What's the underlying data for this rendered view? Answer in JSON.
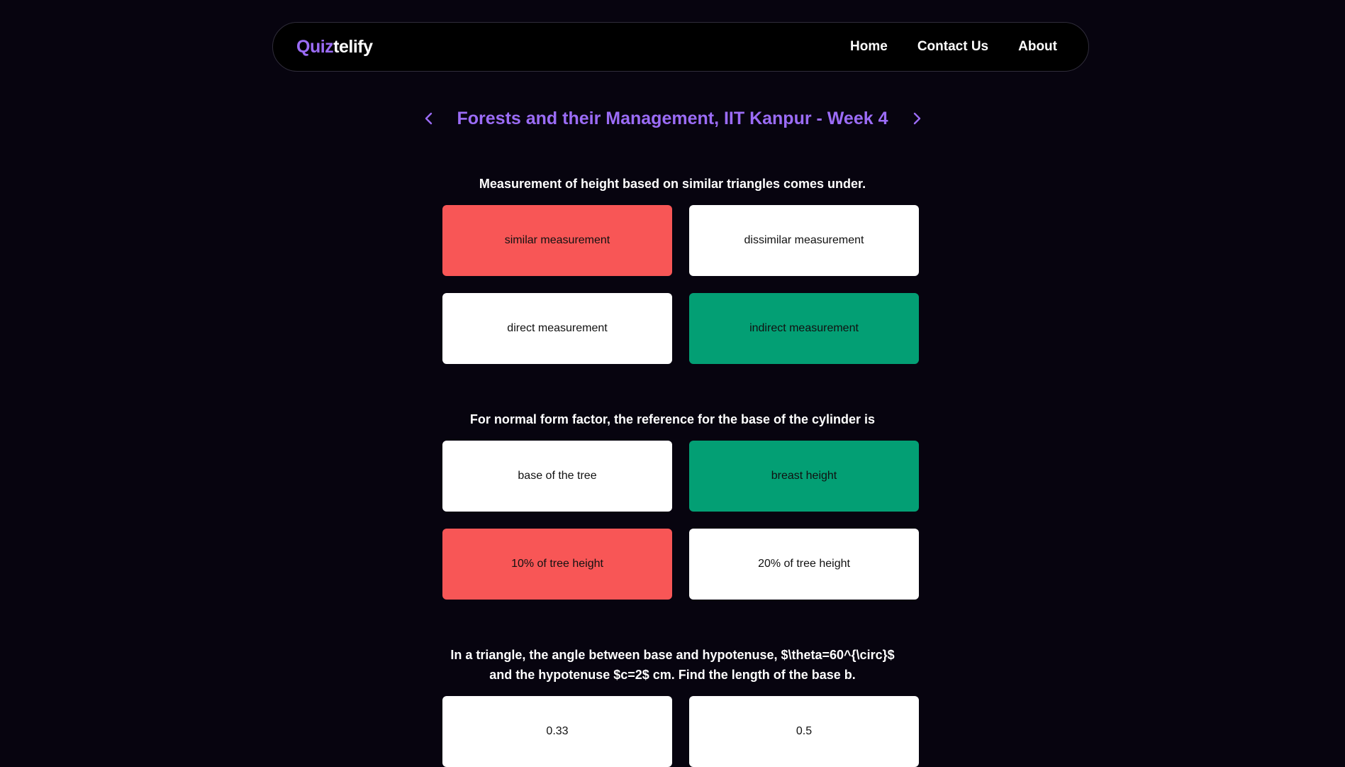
{
  "nav": {
    "logo_part1": "Quiz",
    "logo_part2": "telify",
    "links": [
      "Home",
      "Contact Us",
      "About"
    ]
  },
  "header": {
    "title": "Forests and their Management, IIT Kanpur - Week 4",
    "prev_icon": "chevron-left-icon",
    "next_icon": "chevron-right-icon"
  },
  "colors": {
    "accent": "#9b6cf6",
    "wrong": "#f85656",
    "correct": "#039f74",
    "background": "#07040f"
  },
  "questions": [
    {
      "text": "Measurement of height based on similar triangles comes under.",
      "options": [
        {
          "label": "similar measurement",
          "state": "wrong"
        },
        {
          "label": "dissimilar measurement",
          "state": "neutral"
        },
        {
          "label": "direct measurement",
          "state": "neutral"
        },
        {
          "label": "indirect measurement",
          "state": "correct"
        }
      ]
    },
    {
      "text": "For normal form factor, the reference for the base of the cylinder is",
      "options": [
        {
          "label": "base of the tree",
          "state": "neutral"
        },
        {
          "label": "breast height",
          "state": "correct"
        },
        {
          "label": "10% of tree height",
          "state": "wrong"
        },
        {
          "label": "20% of tree height",
          "state": "neutral"
        }
      ]
    },
    {
      "text": "In a triangle, the angle between base and hypotenuse, $\\theta=60^{\\circ}$ and the hypotenuse $c=2$ cm. Find the length of the base b.",
      "options": [
        {
          "label": "0.33",
          "state": "neutral"
        },
        {
          "label": "0.5",
          "state": "neutral"
        }
      ]
    }
  ]
}
